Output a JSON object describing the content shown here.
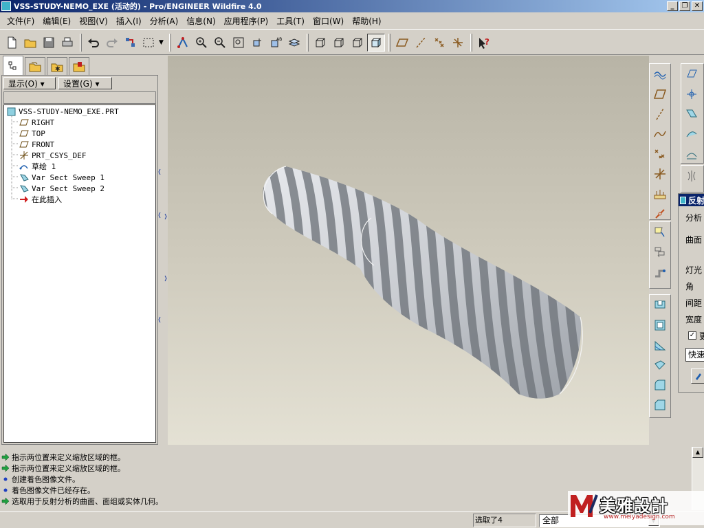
{
  "window": {
    "title": "VSS-STUDY-NEMO_EXE (活动的) - Pro/ENGINEER Wildfire 4.0",
    "controls": [
      "_",
      "❐",
      "✕"
    ]
  },
  "menu": [
    "文件(F)",
    "编辑(E)",
    "视图(V)",
    "插入(I)",
    "分析(A)",
    "信息(N)",
    "应用程序(P)",
    "工具(T)",
    "窗口(W)",
    "帮助(H)"
  ],
  "nav": {
    "display_label": "显示(O) ▾",
    "settings_label": "设置(G) ▾",
    "tree": [
      {
        "label": "VSS-STUDY-NEMO_EXE.PRT",
        "icon": "part-icon"
      },
      {
        "label": "RIGHT",
        "icon": "datum-plane-icon"
      },
      {
        "label": "TOP",
        "icon": "datum-plane-icon"
      },
      {
        "label": "FRONT",
        "icon": "datum-plane-icon"
      },
      {
        "label": "PRT_CSYS_DEF",
        "icon": "csys-icon"
      },
      {
        "label": "草绘 1",
        "icon": "sketch-icon"
      },
      {
        "label": "Var Sect Sweep 1",
        "icon": "sweep-icon"
      },
      {
        "label": "Var Sect Sweep 2",
        "icon": "sweep-icon"
      },
      {
        "label": "在此插入",
        "icon": "insert-here-icon"
      }
    ]
  },
  "dialog": {
    "title": "反射",
    "labels": [
      "分析",
      "曲面",
      "灯光",
      "角",
      "间距",
      "宽度"
    ],
    "checkbox": "更",
    "field": "快速"
  },
  "messages": [
    {
      "icon": "prompt-arrow-icon",
      "text": "指示两位置来定义缩放区域的框。"
    },
    {
      "icon": "prompt-arrow-icon",
      "text": "指示两位置来定义缩放区域的框。"
    },
    {
      "icon": "info-dot-icon",
      "text": "创建着色图像文件。"
    },
    {
      "icon": "info-dot-icon",
      "text": "着色图像文件已经存在。"
    },
    {
      "icon": "prompt-arrow-icon",
      "text": "选取用于反射分析的曲面、面组或实体几何。"
    }
  ],
  "status": {
    "selected": "选取了4",
    "filter": "全部"
  },
  "watermark": {
    "title": "美雅設計",
    "url": "www.meiyadesign.com"
  },
  "colors": {
    "title_bar": "#0a246a",
    "model_light": "#c9ccd1",
    "model_dark": "#6e737a",
    "viewport_top": "#b8b4a6",
    "viewport_bottom": "#e4e1d4"
  }
}
